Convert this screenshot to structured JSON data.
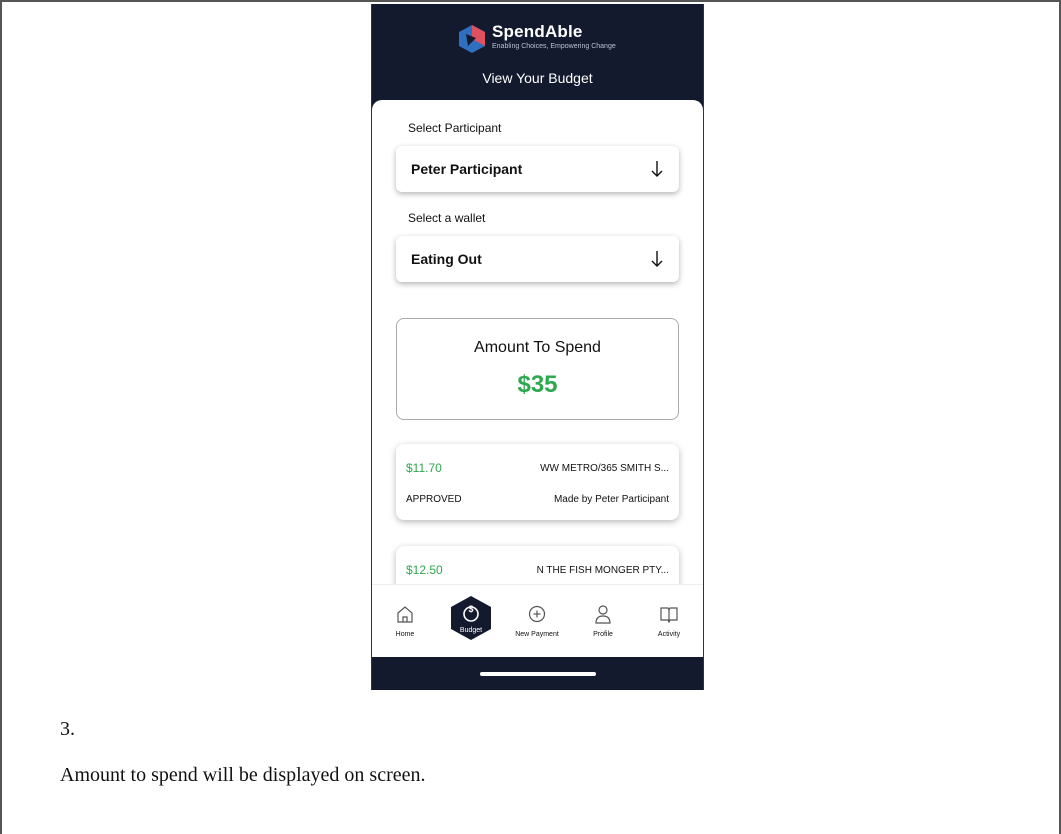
{
  "app": {
    "name": "SpendAble",
    "tagline": "Enabling Choices, Empowering Change",
    "screen_title": "View Your Budget",
    "colors": {
      "header_bg": "#131a2e",
      "accent_green": "#2ea84f",
      "logo_red": "#e0505e",
      "logo_blue": "#2f6fbf"
    }
  },
  "participant": {
    "label": "Select Participant",
    "value": "Peter Participant",
    "icon": "arrow-down-icon"
  },
  "wallet": {
    "label": "Select a wallet",
    "value": "Eating Out",
    "icon": "arrow-down-icon"
  },
  "amount": {
    "title": "Amount To Spend",
    "value": "$35"
  },
  "transactions": [
    {
      "amount": "$11.70",
      "merchant": "WW METRO/365 SMITH S...",
      "status": "APPROVED",
      "made_by": "Made by Peter Participant"
    },
    {
      "amount": "$12.50",
      "merchant": "N THE FISH MONGER PTY..."
    }
  ],
  "nav": {
    "items": [
      {
        "label": "Home",
        "icon": "home-icon"
      },
      {
        "label": "Budget",
        "icon": "dollar-icon",
        "active": true
      },
      {
        "label": "New Payment",
        "icon": "plus-circle-icon"
      },
      {
        "label": "Profile",
        "icon": "user-icon"
      },
      {
        "label": "Activity",
        "icon": "book-icon"
      }
    ]
  },
  "document": {
    "step_number": "3.",
    "caption": "Amount to spend will be displayed on screen."
  }
}
